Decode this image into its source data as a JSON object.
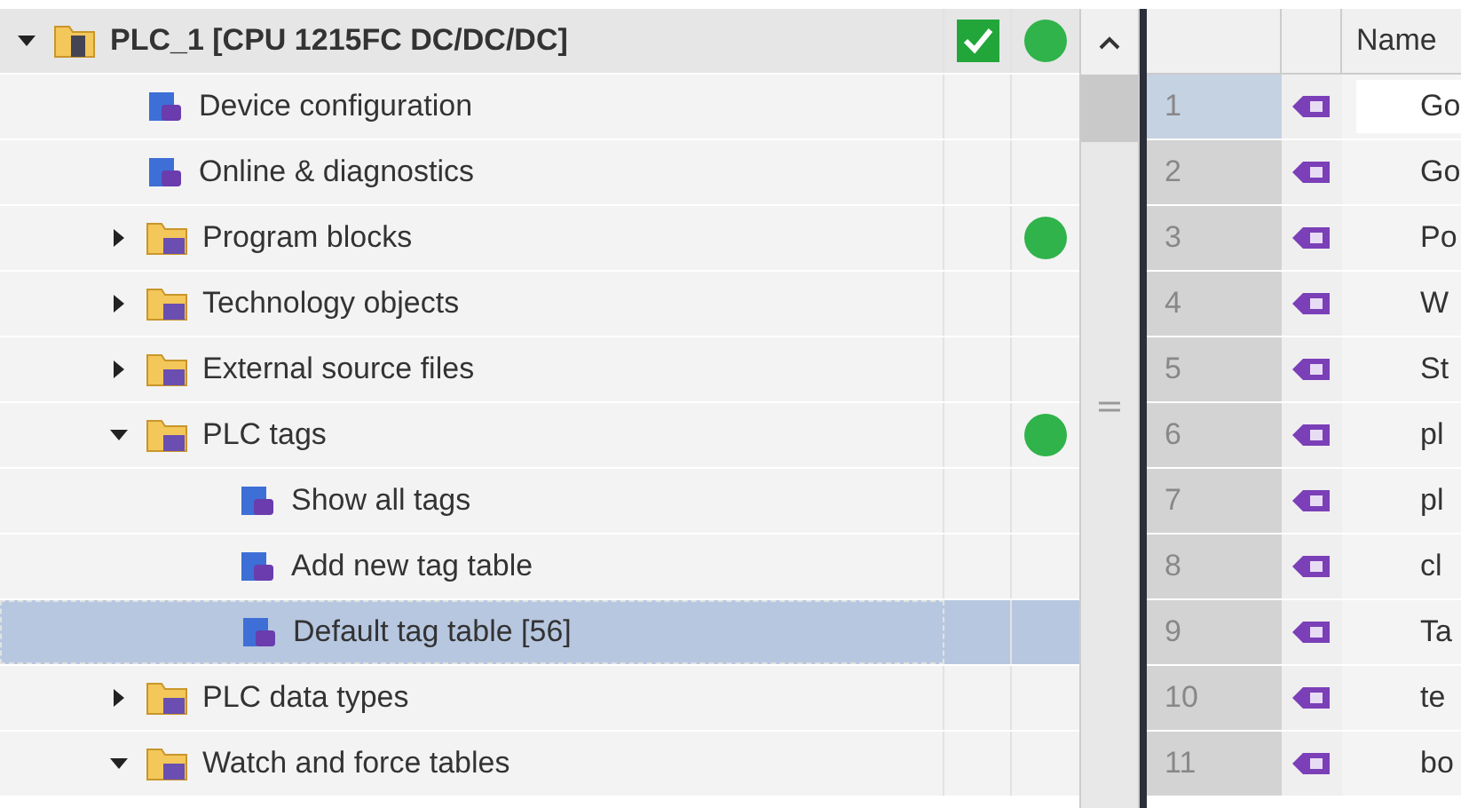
{
  "project_tree": {
    "items": [
      {
        "label": "PLC_1 [CPU 1215FC DC/DC/DC]",
        "kind": "device",
        "expanded": true,
        "consistent": true,
        "online": true,
        "selected": false,
        "children": [
          {
            "label": "Device configuration",
            "kind": "item",
            "online": false,
            "selected": false
          },
          {
            "label": "Online & diagnostics",
            "kind": "item",
            "online": false,
            "selected": false
          },
          {
            "label": "Program blocks",
            "kind": "folder",
            "expanded": false,
            "online": true,
            "selected": false
          },
          {
            "label": "Technology objects",
            "kind": "folder",
            "expanded": false,
            "online": false,
            "selected": false
          },
          {
            "label": "External source files",
            "kind": "folder",
            "expanded": false,
            "online": false,
            "selected": false
          },
          {
            "label": "PLC tags",
            "kind": "folder",
            "expanded": true,
            "online": true,
            "selected": false,
            "children": [
              {
                "label": "Show all tags",
                "kind": "item",
                "online": false,
                "selected": false
              },
              {
                "label": "Add new tag table",
                "kind": "item",
                "online": false,
                "selected": false
              },
              {
                "label": "Default tag table [56]",
                "kind": "item",
                "online": false,
                "selected": true
              }
            ]
          },
          {
            "label": "PLC data types",
            "kind": "folder",
            "expanded": false,
            "online": false,
            "selected": false
          },
          {
            "label": "Watch and force tables",
            "kind": "folder",
            "expanded": true,
            "online": false,
            "selected": false
          }
        ]
      }
    ]
  },
  "tag_table": {
    "columns": [
      "Name"
    ],
    "rows": [
      {
        "number": "1",
        "name": "Go",
        "selected": true
      },
      {
        "number": "2",
        "name": "Go",
        "selected": false
      },
      {
        "number": "3",
        "name": "Po",
        "selected": false
      },
      {
        "number": "4",
        "name": "W",
        "selected": false
      },
      {
        "number": "5",
        "name": "St",
        "selected": false
      },
      {
        "number": "6",
        "name": "pl",
        "selected": false
      },
      {
        "number": "7",
        "name": "pl",
        "selected": false
      },
      {
        "number": "8",
        "name": "cl",
        "selected": false
      },
      {
        "number": "9",
        "name": "Ta",
        "selected": false
      },
      {
        "number": "10",
        "name": "te",
        "selected": false
      },
      {
        "number": "11",
        "name": "bo",
        "selected": false
      }
    ]
  }
}
